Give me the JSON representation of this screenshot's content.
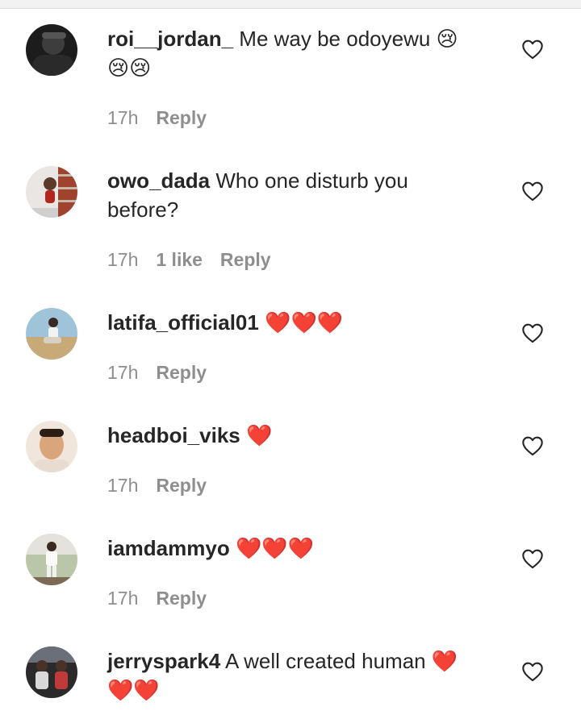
{
  "comments": [
    {
      "username": "roi__jordan_",
      "text": " Me way be odoyewu 😢",
      "text2": "😢😢",
      "time": "17h",
      "likes": "",
      "reply": "Reply"
    },
    {
      "username": "owo_dada",
      "text": " Who one disturb you",
      "text2": "before?",
      "time": "17h",
      "likes": "1 like",
      "reply": "Reply"
    },
    {
      "username": "latifa_official01",
      "text": " ❤️❤️❤️",
      "text2": "",
      "time": "17h",
      "likes": "",
      "reply": "Reply"
    },
    {
      "username": "headboi_viks",
      "text": " ❤️",
      "text2": "",
      "time": "17h",
      "likes": "",
      "reply": "Reply"
    },
    {
      "username": "iamdammyo",
      "text": " ❤️❤️❤️",
      "text2": "",
      "time": "17h",
      "likes": "",
      "reply": "Reply"
    },
    {
      "username": "jerryspark4",
      "text": " A well created human ❤️",
      "text2": "❤️❤️",
      "time": "",
      "likes": "",
      "reply": ""
    }
  ],
  "colors": {
    "text": "#262626",
    "meta": "#8e8e8e",
    "separator": "#dcdcdc"
  },
  "icons": {
    "like": "heart-outline-icon"
  }
}
